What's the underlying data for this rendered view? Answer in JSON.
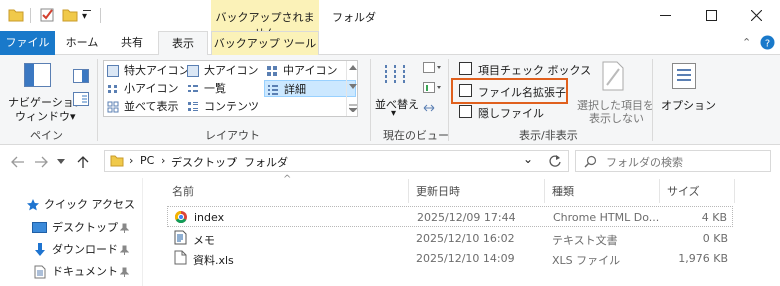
{
  "title_bar": {
    "context_tab": "バックアップされません",
    "title": "フォルダ",
    "qat_dropdown_glyph": "▾"
  },
  "ribbon_tabs": {
    "file": "ファイル",
    "home": "ホーム",
    "share": "共有",
    "view": "表示",
    "backup_tools": "バックアップ ツール",
    "expand_glyph": "⌃"
  },
  "ribbon": {
    "pane_group": {
      "nav_pane_line1": "ナビゲーション",
      "nav_pane_line2": "ウィンドウ▾",
      "label": "ペイン"
    },
    "layout_group": {
      "items": [
        "特大アイコン",
        "大アイコン",
        "中アイコン",
        "小アイコン",
        "一覧",
        "詳細",
        "並べて表示",
        "コンテンツ"
      ],
      "label": "レイアウト"
    },
    "current_view_group": {
      "sort_label": "並べ替え",
      "sort_arrow": "▾",
      "label": "現在のビュー"
    },
    "show_hide_group": {
      "item_checkboxes": "項目チェック ボックス",
      "file_extensions": "ファイル名拡張子",
      "hidden_files": "隠しファイル",
      "hide_selected_line1": "選択した項目を",
      "hide_selected_line2": "表示しない",
      "label": "表示/非表示"
    },
    "options_label": "オプション"
  },
  "address_bar": {
    "crumb_pc": "PC",
    "crumb_desktop": "デスクトップ",
    "crumb_folder": "フォルダ",
    "sep": "›",
    "dropdown_glyph": "⌄",
    "search_placeholder": "フォルダの検索"
  },
  "nav_pane": {
    "items": [
      "クイック アクセス",
      "デスクトップ",
      "ダウンロード",
      "ドキュメント"
    ]
  },
  "file_list": {
    "columns": [
      "名前",
      "更新日時",
      "種類",
      "サイズ"
    ],
    "sort_indicator": "^",
    "rows": [
      {
        "name": "index",
        "modified": "2025/12/09 17:44",
        "type": "Chrome HTML Do...",
        "size": "4 KB"
      },
      {
        "name": "メモ",
        "modified": "2025/12/10 16:02",
        "type": "テキスト文書",
        "size": "0 KB"
      },
      {
        "name": "資料.xls",
        "modified": "2025/12/10 14:09",
        "type": "XLS ファイル",
        "size": "1,976 KB"
      }
    ]
  },
  "colors": {
    "file_tab": "#1979ca",
    "context_tab": "#fbf2b8",
    "highlight_frame": "#e0601e",
    "selection": "#cce8ff"
  }
}
